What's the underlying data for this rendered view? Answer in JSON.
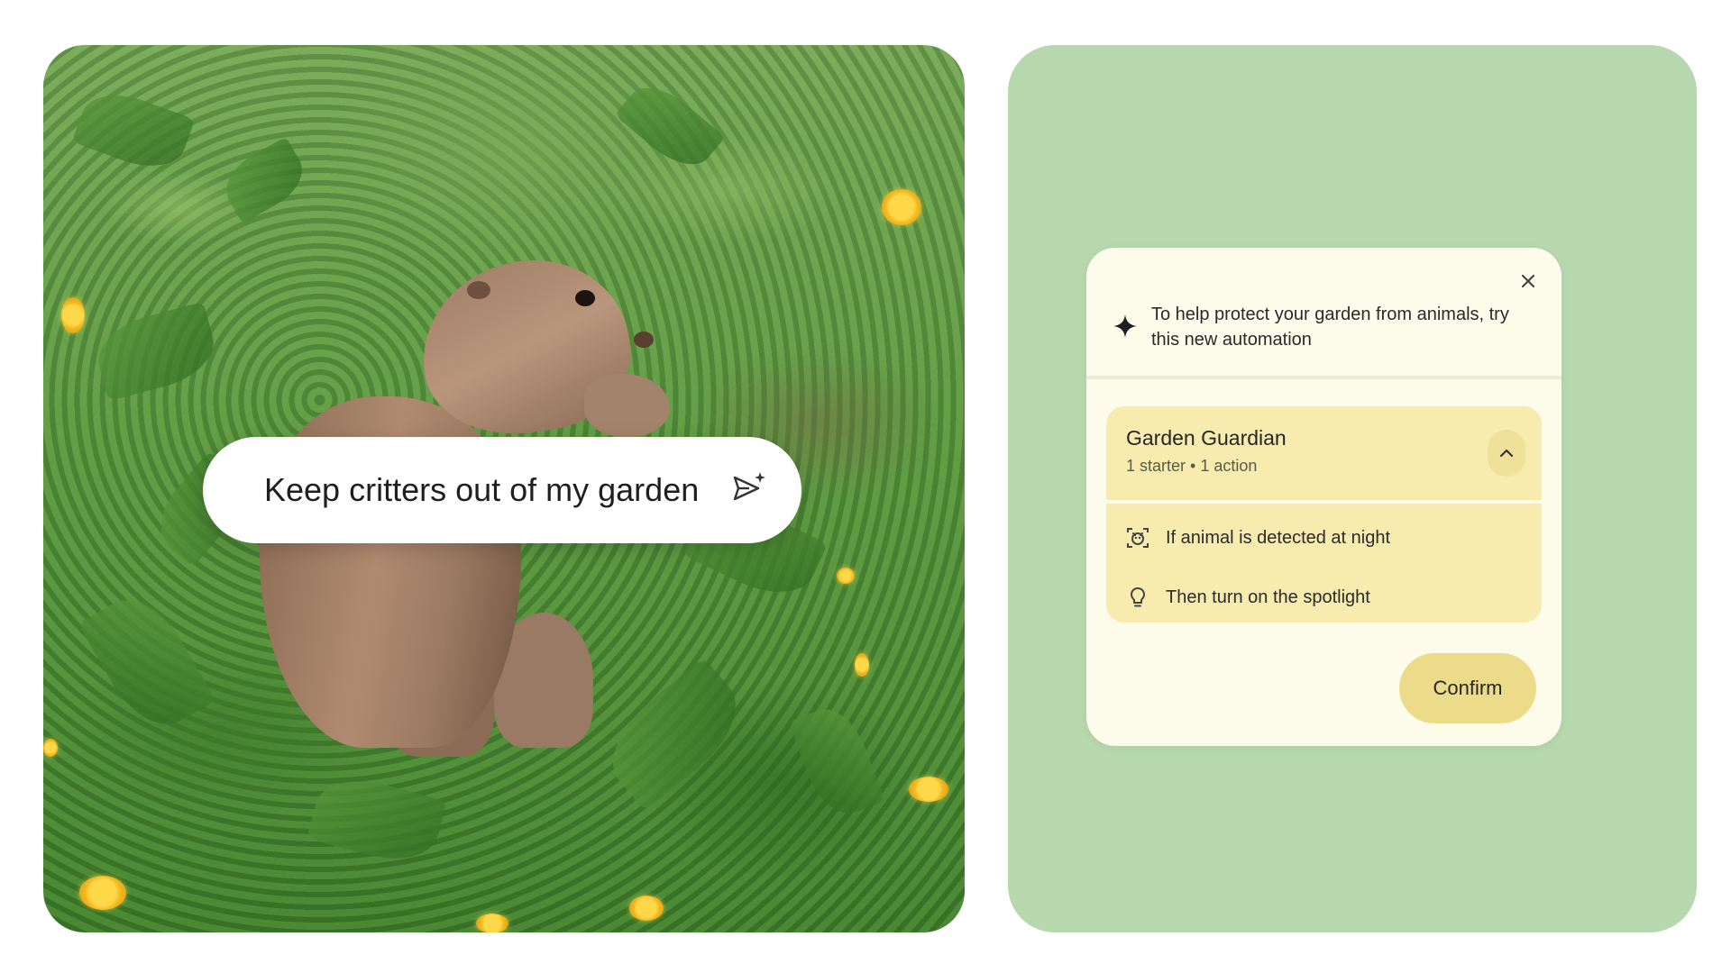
{
  "prompt": {
    "text": "Keep critters out of my garden",
    "send_icon": "send-sparkle-icon"
  },
  "suggestion_card": {
    "close_icon": "close-icon",
    "sparkle_icon": "sparkle-icon",
    "message": "To help protect your garden from animals, try this new automation"
  },
  "automation": {
    "title": "Garden Guardian",
    "subtitle": "1 starter • 1 action",
    "collapse_icon": "chevron-up-icon",
    "starter": {
      "icon": "camera-detect-icon",
      "label": "If animal is detected at night"
    },
    "action": {
      "icon": "lightbulb-icon",
      "label": "Then turn on the spotlight"
    }
  },
  "confirm_label": "Confirm",
  "colors": {
    "green_panel": "#b7d7ae",
    "card_bg": "#fdfbe9",
    "automation_bg": "#f7ecad",
    "confirm_bg": "#ecdc8a"
  }
}
